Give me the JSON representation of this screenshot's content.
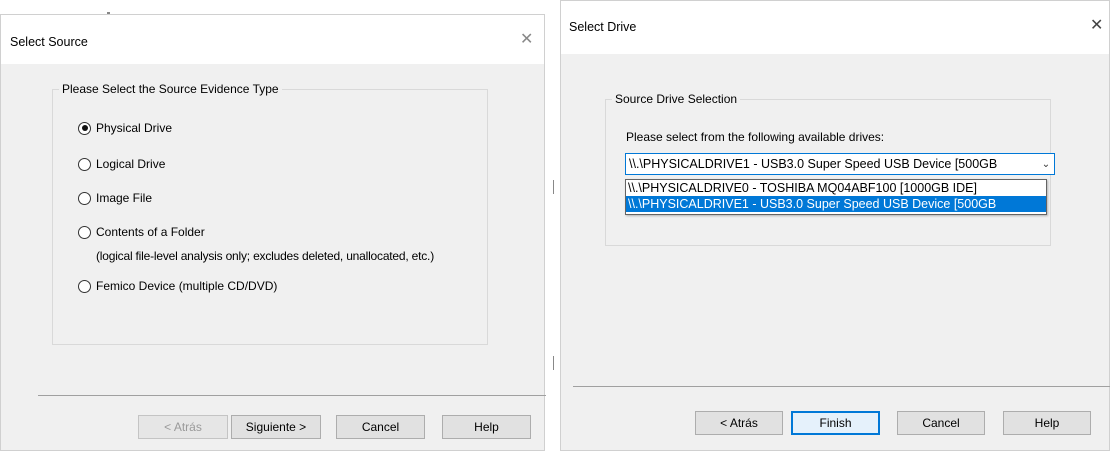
{
  "select_source": {
    "title": "Select Source",
    "close_glyph": "✕",
    "group_title": "Please Select the Source Evidence Type",
    "options": [
      {
        "label": "Physical Drive",
        "checked": true
      },
      {
        "label": "Logical Drive",
        "checked": false
      },
      {
        "label": "Image File",
        "checked": false
      },
      {
        "label": "Contents of a Folder",
        "checked": false
      },
      {
        "label": "Femico Device (multiple CD/DVD)",
        "checked": false
      }
    ],
    "folder_note": "(logical file-level analysis only; excludes deleted, unallocated, etc.)",
    "buttons": {
      "back": "< Atrás",
      "next": "Siguiente >",
      "cancel": "Cancel",
      "help": "Help"
    }
  },
  "select_drive": {
    "title": "Select Drive",
    "close_glyph": "✕",
    "group_title": "Source Drive Selection",
    "prompt": "Please select from the following available drives:",
    "combo_value": "\\\\.\\PHYSICALDRIVE1 - USB3.0  Super Speed USB Device [500GB",
    "combo_arrow": "⌄",
    "drives": [
      {
        "label": "\\\\.\\PHYSICALDRIVE0 - TOSHIBA MQ04ABF100 [1000GB IDE]",
        "selected": false
      },
      {
        "label": "\\\\.\\PHYSICALDRIVE1 - USB3.0  Super Speed USB Device [500GB",
        "selected": true
      }
    ],
    "buttons": {
      "back": "< Atrás",
      "finish": "Finish",
      "cancel": "Cancel",
      "help": "Help"
    }
  },
  "colors": {
    "dialog_bg": "#f0f0f0",
    "titlebar_bg": "#ffffff",
    "accent": "#0078d7",
    "disabled_text": "#9a9a9a"
  }
}
